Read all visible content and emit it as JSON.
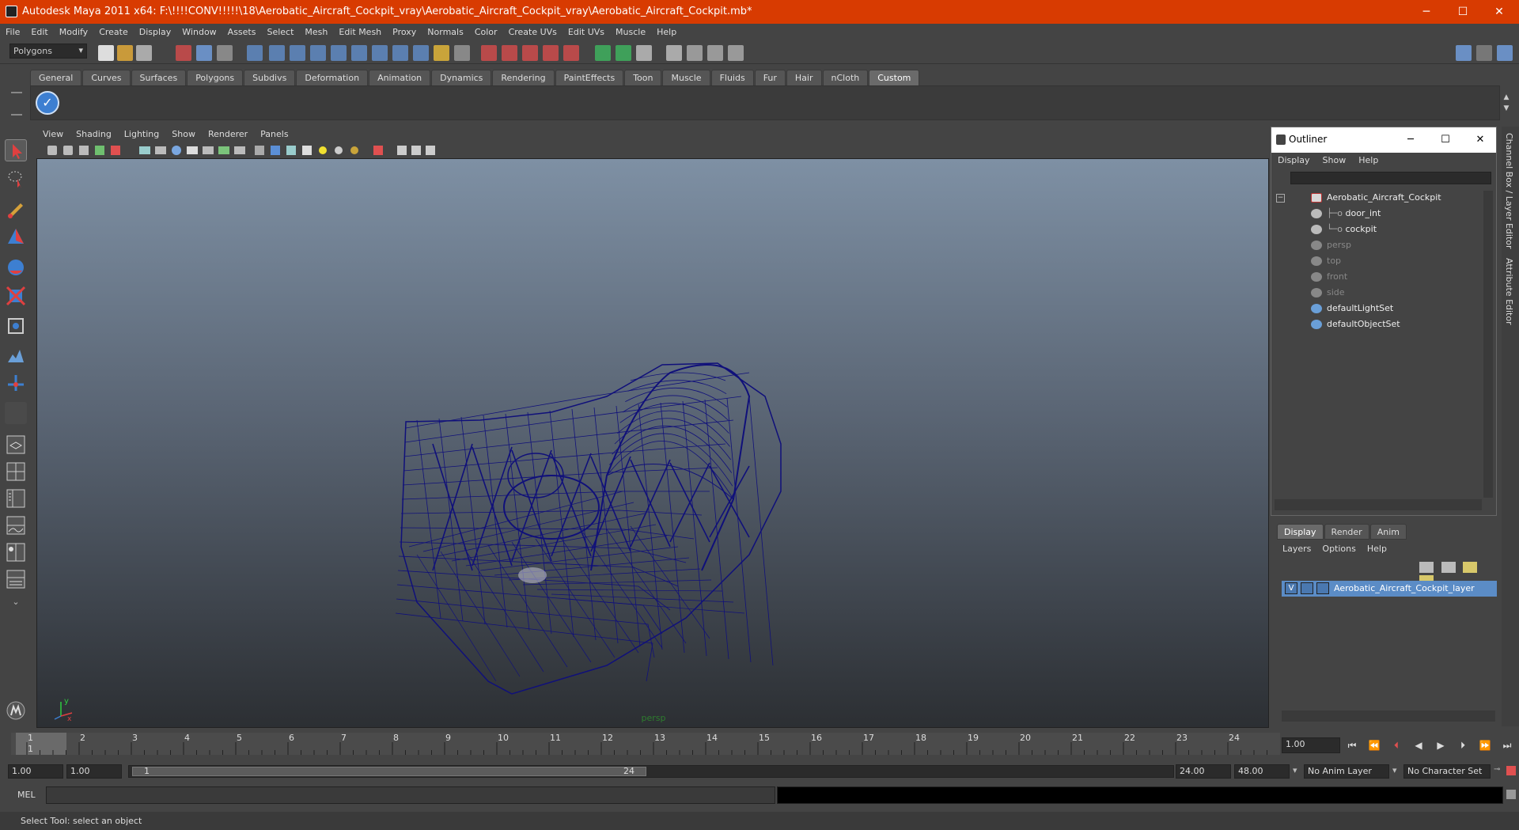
{
  "window": {
    "title": "Autodesk Maya 2011 x64: F:\\!!!!CONV!!!!!\\18\\Aerobatic_Aircraft_Cockpit_vray\\Aerobatic_Aircraft_Cockpit_vray\\Aerobatic_Aircraft_Cockpit.mb*",
    "minimize": "─",
    "maximize": "☐",
    "close": "✕"
  },
  "menubar": [
    "File",
    "Edit",
    "Modify",
    "Create",
    "Display",
    "Window",
    "Assets",
    "Select",
    "Mesh",
    "Edit Mesh",
    "Proxy",
    "Normals",
    "Color",
    "Create UVs",
    "Edit UVs",
    "Muscle",
    "Help"
  ],
  "statusline": {
    "menu_set": "Polygons"
  },
  "shelf": {
    "tabs": [
      "General",
      "Curves",
      "Surfaces",
      "Polygons",
      "Subdivs",
      "Deformation",
      "Animation",
      "Dynamics",
      "Rendering",
      "PaintEffects",
      "Toon",
      "Muscle",
      "Fluids",
      "Fur",
      "Hair",
      "nCloth",
      "Custom"
    ],
    "active_tab": "Custom"
  },
  "viewport": {
    "menus": [
      "View",
      "Shading",
      "Lighting",
      "Show",
      "Renderer",
      "Panels"
    ],
    "camera_label": "persp",
    "wire_color": "#10107a"
  },
  "outliner": {
    "title": "Outliner",
    "menus": [
      "Display",
      "Show",
      "Help"
    ],
    "items": [
      {
        "label": "Aerobatic_Aircraft_Cockpit",
        "dim": false
      },
      {
        "label": "door_int",
        "dim": false
      },
      {
        "label": "cockpit",
        "dim": false
      },
      {
        "label": "persp",
        "dim": true
      },
      {
        "label": "top",
        "dim": true
      },
      {
        "label": "front",
        "dim": true
      },
      {
        "label": "side",
        "dim": true
      },
      {
        "label": "defaultLightSet",
        "dim": false
      },
      {
        "label": "defaultObjectSet",
        "dim": false
      }
    ]
  },
  "layer_editor": {
    "tabs": [
      "Display",
      "Render",
      "Anim"
    ],
    "active_tab": "Display",
    "menus": [
      "Layers",
      "Options",
      "Help"
    ],
    "layer": {
      "visible": "V",
      "name": "Aerobatic_Aircraft_Cockpit_layer"
    }
  },
  "side_tabs": [
    "Channel Box / Layer Editor",
    "Attribute Editor"
  ],
  "time_slider": {
    "ticks": [
      "1",
      "2",
      "3",
      "4",
      "5",
      "6",
      "7",
      "8",
      "9",
      "10",
      "11",
      "12",
      "13",
      "14",
      "15",
      "16",
      "17",
      "18",
      "19",
      "20",
      "21",
      "22",
      "23",
      "24"
    ],
    "current_marker": "1",
    "current_frame": "1.00"
  },
  "range_slider": {
    "start_time": "1.00",
    "playback_start": "1.00",
    "range_start": "1",
    "range_end": "24",
    "playback_end": "24.00",
    "end_time": "48.00",
    "anim_layer": "No Anim Layer",
    "character_set": "No Character Set"
  },
  "command_line": {
    "label": "MEL"
  },
  "help_line": "Select Tool: select an object"
}
